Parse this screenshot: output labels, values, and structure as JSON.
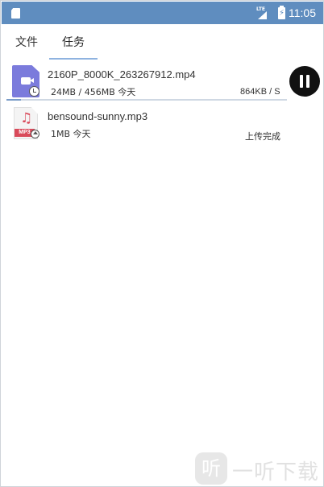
{
  "status_bar": {
    "network": "LTE",
    "time": "11:05",
    "background_color": "#5f8dbf"
  },
  "tabs": [
    {
      "label": "文件"
    },
    {
      "label": "任务",
      "active": true
    }
  ],
  "tasks": [
    {
      "file_name": "2160P_8000K_263267912.mp4",
      "size_info": "24MB / 456MB 今天",
      "speed": "864KB / S",
      "progress": 0.053,
      "icon": "video-file-icon",
      "status_icon": "clock-icon",
      "action_icon": "pause-icon"
    },
    {
      "file_name": "bensound-sunny.mp3",
      "size_info": "1MB 今天",
      "status_text": "上传完成",
      "icon": "mp3-file-icon",
      "file_tag": "MP3",
      "status_icon": "upload-icon"
    }
  ],
  "watermark": {
    "logo_char": "听",
    "text": "一听下载"
  }
}
